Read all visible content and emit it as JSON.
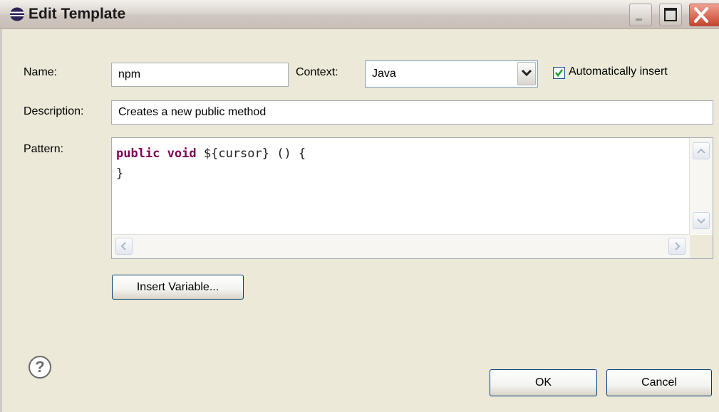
{
  "window": {
    "title": "Edit Template"
  },
  "form": {
    "name_label": "Name:",
    "name_value": "npm",
    "context_label": "Context:",
    "context_value": "Java",
    "auto_insert_label": "Automatically insert",
    "auto_insert_checked": true,
    "description_label": "Description:",
    "description_value": "Creates a new public method",
    "pattern_label": "Pattern:",
    "pattern": {
      "line1_kw1": "public",
      "line1_kw2": "void",
      "line1_rest": "${cursor} () {",
      "line2": "}"
    }
  },
  "buttons": {
    "insert_variable": "Insert Variable...",
    "ok": "OK",
    "cancel": "Cancel",
    "help": "?"
  },
  "colors": {
    "keyword": "#7f0055",
    "checkmark": "#21a121",
    "dialog_bg": "#ece9d8"
  }
}
